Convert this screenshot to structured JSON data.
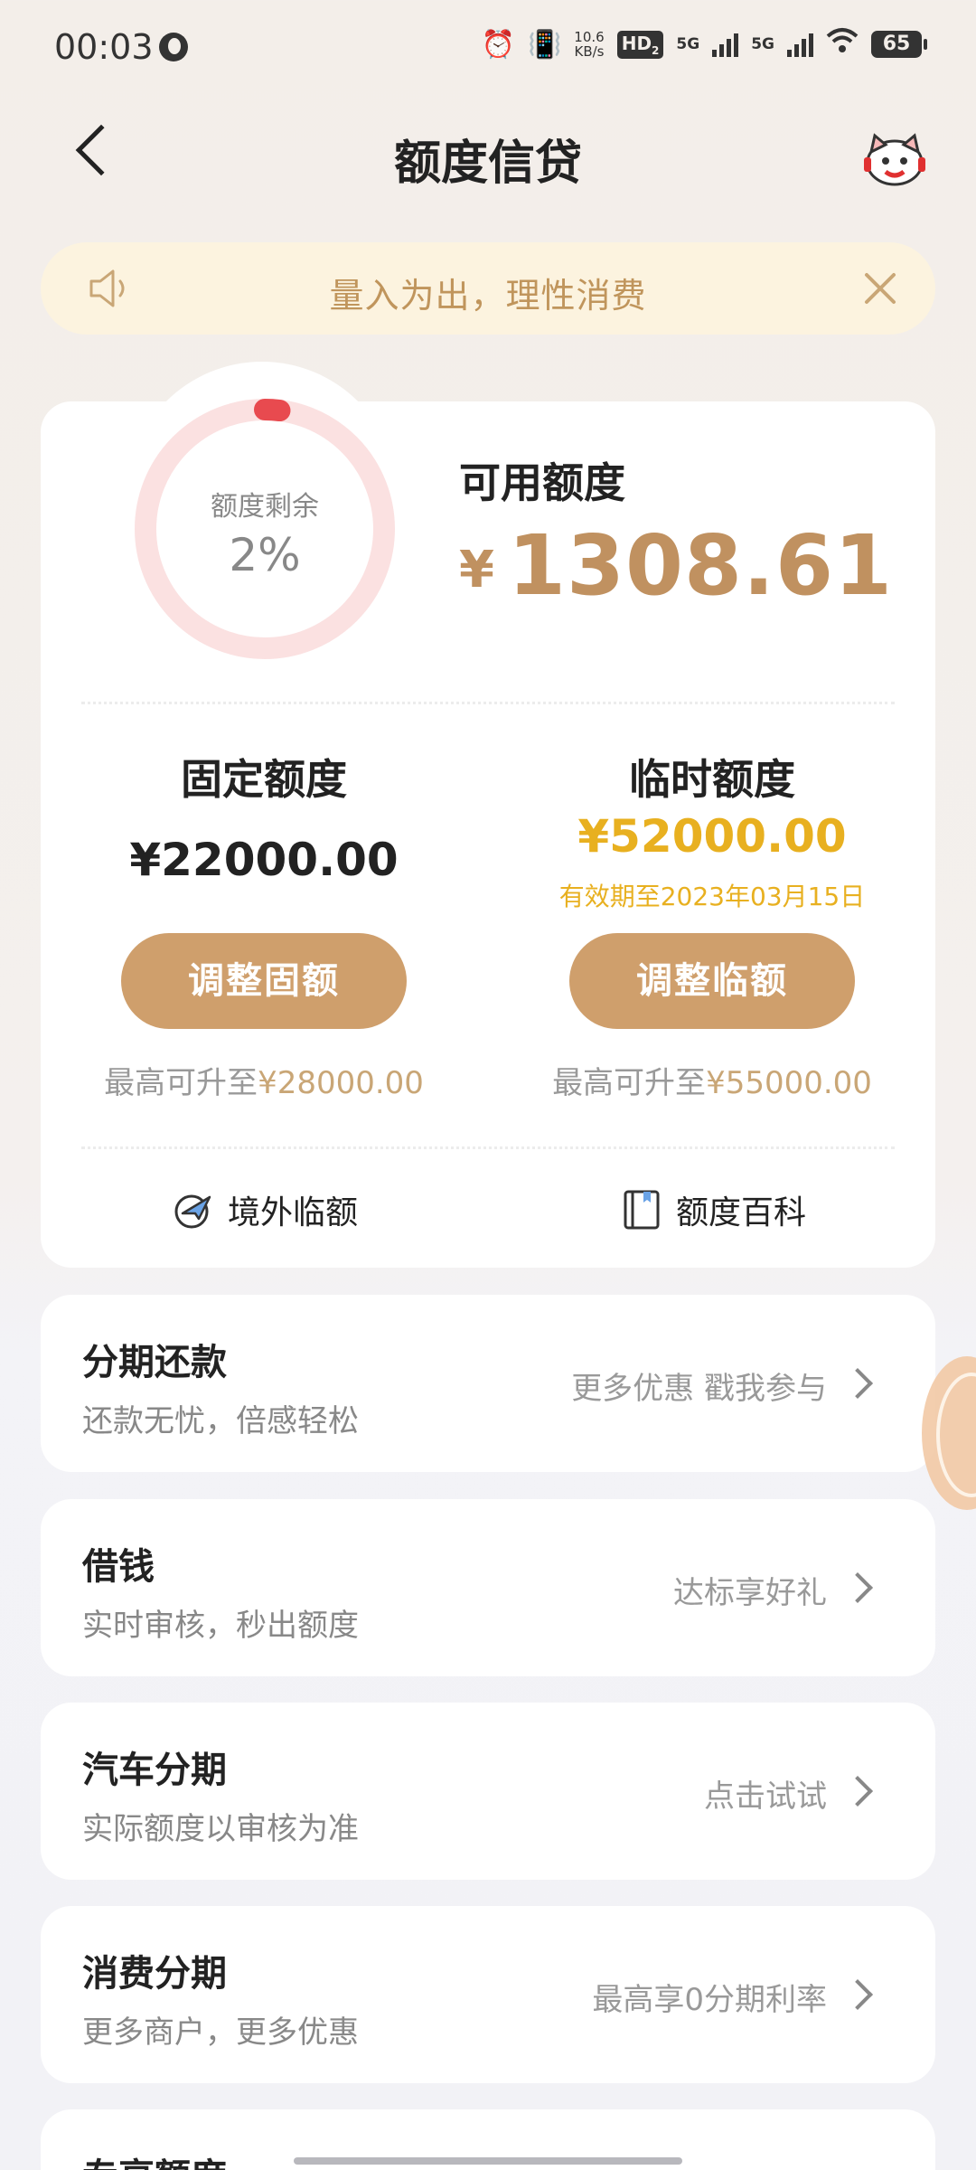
{
  "status_bar": {
    "time": "00:03",
    "net_speed_value": "10.6",
    "net_speed_unit": "KB/s",
    "hd_label": "HD",
    "hd_sub": "2",
    "net1": "5G",
    "net2": "5G",
    "battery": "65"
  },
  "header": {
    "title": "额度信贷"
  },
  "notice": {
    "text": "量入为出，理性消费"
  },
  "credit": {
    "ring_label": "额度剩余",
    "ring_percent_text": "2%",
    "remaining_fraction": 0.02,
    "available_label": "可用额度",
    "currency_symbol": "¥",
    "available_amount": "1308.61",
    "fixed": {
      "title": "固定额度",
      "amount": "¥22000.00",
      "button": "调整固额",
      "max_prefix": "最高可升至",
      "max_value": "¥28000.00"
    },
    "temporary": {
      "title": "临时额度",
      "amount": "¥52000.00",
      "validity": "有效期至2023年03月15日",
      "button": "调整临额",
      "max_prefix": "最高可升至",
      "max_value": "¥55000.00"
    },
    "links": {
      "overseas": "境外临额",
      "encyclopedia": "额度百科"
    }
  },
  "services": [
    {
      "title": "分期还款",
      "subtitle": "还款无忧，倍感轻松",
      "action": "更多优惠 戳我参与"
    },
    {
      "title": "借钱",
      "subtitle": "实时审核，秒出额度",
      "action": "达标享好礼"
    },
    {
      "title": "汽车分期",
      "subtitle": "实际额度以审核为准",
      "action": "点击试试"
    },
    {
      "title": "消费分期",
      "subtitle": "更多商户，更多优惠",
      "action": "最高享0分期利率"
    },
    {
      "title": "专享额度"
    }
  ],
  "colors": {
    "gold": "#c09160",
    "button": "#cf9f6c",
    "highlight": "#e8b020",
    "ring_track": "#fbe1e1",
    "ring_progress": "#e84a4f",
    "notice_bg": "#fcf3df"
  }
}
